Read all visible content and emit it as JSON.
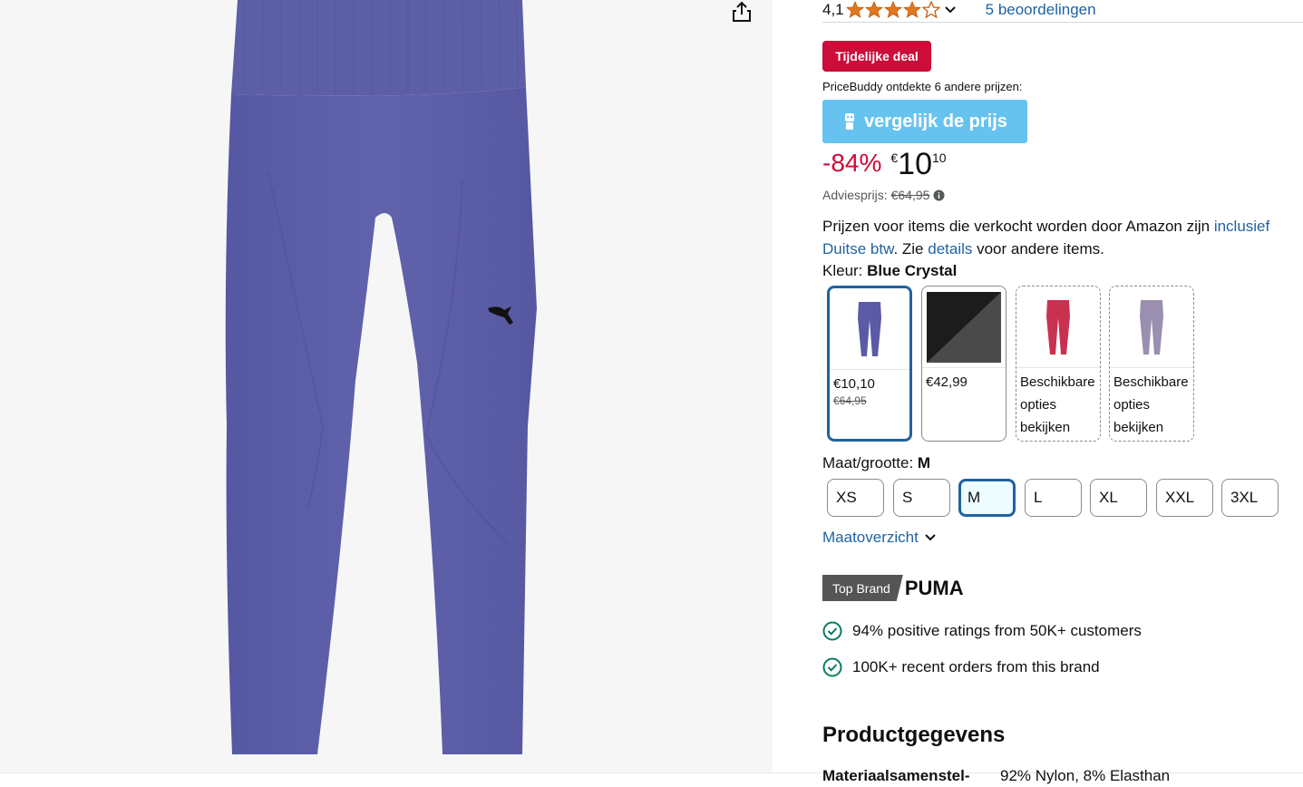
{
  "rating": {
    "value": "4,1",
    "stars": 4,
    "reviews_link": "5 beoordelingen"
  },
  "deal": {
    "badge": "Tijdelijke deal"
  },
  "pricebuddy": {
    "text": "PriceBuddy ontdekte 6 andere prijzen:",
    "button": "vergelijk de prijs"
  },
  "price": {
    "discount": "-84%",
    "currency": "€",
    "whole": "10",
    "fraction": "10",
    "list_label": "Adviesprijs:",
    "list_price": "€64,95"
  },
  "vat": {
    "part1": "Prijzen voor items die verkocht worden door Amazon zijn ",
    "link1": "inclusief Duitse btw",
    "part2": ". Zie ",
    "link2": "details",
    "part3": " voor andere items."
  },
  "color": {
    "label": "Kleur: ",
    "selected": "Blue Crystal",
    "options": [
      {
        "price": "€10,10",
        "old": "€64,95",
        "color": "#5a5aa6"
      },
      {
        "price": "€42,99",
        "old": "",
        "color": "#222222"
      },
      {
        "line1": "Beschikbare",
        "line2": "opties",
        "line3": "bekijken",
        "color": "#c8324f"
      },
      {
        "line1": "Beschikbare",
        "line2": "opties",
        "line3": "bekijken",
        "color": "#9a8fb0"
      }
    ]
  },
  "size": {
    "label": "Maat/grootte: ",
    "selected": "M",
    "options": [
      "XS",
      "S",
      "M",
      "L",
      "XL",
      "XXL",
      "3XL"
    ],
    "chart_link": "Maatoverzicht"
  },
  "brand": {
    "badge": "Top Brand",
    "name": "PUMA",
    "point1": "94% positive ratings from 50K+ customers",
    "point2": "100K+ recent orders from this brand"
  },
  "details": {
    "heading": "Productgegevens",
    "material_key": "Materiaalsamenstel-",
    "material_val": "92% Nylon, 8% Elasthan"
  },
  "colors": {
    "accent_blue": "#2162a1",
    "deal_red": "#cc0c39",
    "compare_btn": "#66c3f0",
    "legging": "#5d5ea8"
  }
}
